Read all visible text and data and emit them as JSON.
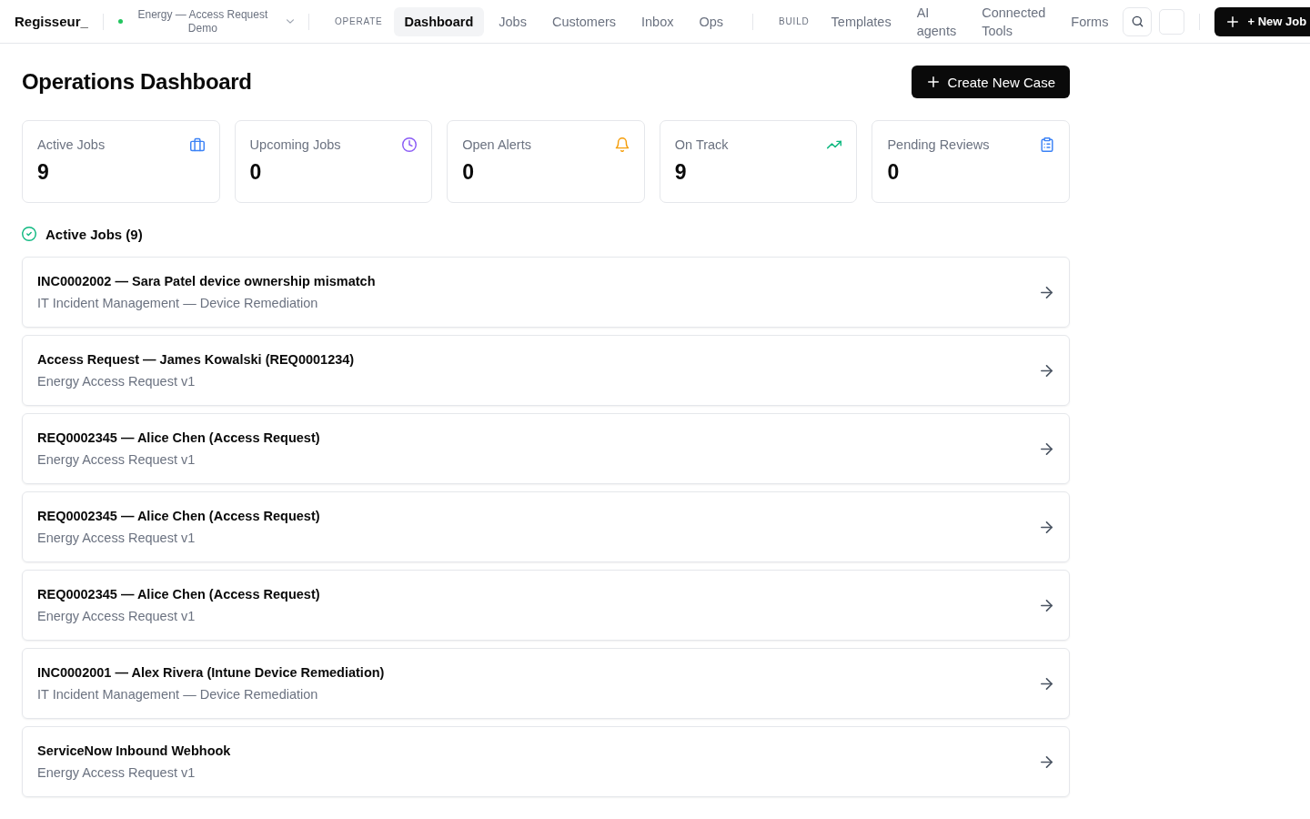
{
  "app": {
    "brand": "Regisseur_",
    "workspace": "Energy — Access Request Demo"
  },
  "nav": {
    "groups": [
      {
        "label": "OPERATE",
        "items": [
          {
            "label": "Dashboard",
            "selected": true
          },
          {
            "label": "Jobs",
            "selected": false
          },
          {
            "label": "Customers",
            "selected": false
          },
          {
            "label": "Inbox",
            "selected": false
          },
          {
            "label": "Ops",
            "selected": false
          }
        ]
      },
      {
        "label": "BUILD",
        "items": [
          {
            "label": "Templates",
            "selected": false
          },
          {
            "label": "AI agents",
            "selected": false
          },
          {
            "label": "Connected Tools",
            "selected": false
          },
          {
            "label": "Forms",
            "selected": false
          }
        ]
      }
    ]
  },
  "actions": {
    "new_job": "+ New Job"
  },
  "page": {
    "title": "Operations Dashboard",
    "create_button": "Create New Case"
  },
  "stats": [
    {
      "label": "Active Jobs",
      "value": "9",
      "color": "#3b82f6"
    },
    {
      "label": "Upcoming Jobs",
      "value": "0",
      "color": "#8b5cf6"
    },
    {
      "label": "Open Alerts",
      "value": "0",
      "color": "#f59e0b"
    },
    {
      "label": "On Track",
      "value": "9",
      "color": "#10b981"
    },
    {
      "label": "Pending Reviews",
      "value": "0",
      "color": "#3b82f6"
    }
  ],
  "active_jobs": {
    "heading": "Active Jobs (9)",
    "jobs": [
      {
        "title": "INC0002002 — Sara Patel device ownership mismatch",
        "subtitle": "IT Incident Management — Device Remediation"
      },
      {
        "title": "Access Request — James Kowalski (REQ0001234)",
        "subtitle": "Energy Access Request v1"
      },
      {
        "title": "REQ0002345 — Alice Chen (Access Request)",
        "subtitle": "Energy Access Request v1"
      },
      {
        "title": "REQ0002345 — Alice Chen (Access Request)",
        "subtitle": "Energy Access Request v1"
      },
      {
        "title": "REQ0002345 — Alice Chen (Access Request)",
        "subtitle": "Energy Access Request v1"
      },
      {
        "title": "INC0002001 — Alex Rivera (Intune Device Remediation)",
        "subtitle": "IT Incident Management — Device Remediation"
      },
      {
        "title": "ServiceNow Inbound Webhook",
        "subtitle": "Energy Access Request v1"
      }
    ]
  }
}
